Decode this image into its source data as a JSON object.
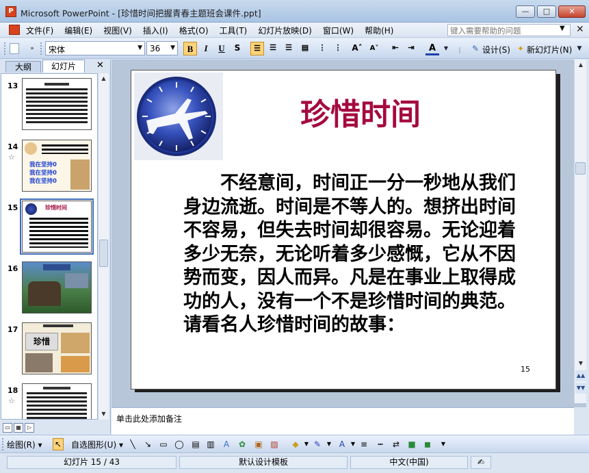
{
  "window": {
    "title": "Microsoft PowerPoint - [珍惜时间把握青春主题班会课件.ppt]",
    "app_icon_letter": "P",
    "min_glyph": "—",
    "max_glyph": "□",
    "close_glyph": "✕"
  },
  "menu": {
    "items": [
      "文件(F)",
      "编辑(E)",
      "视图(V)",
      "插入(I)",
      "格式(O)",
      "工具(T)",
      "幻灯片放映(D)",
      "窗口(W)",
      "帮助(H)"
    ],
    "help_placeholder": "键入需要帮助的问题",
    "close_glyph": "✕"
  },
  "toolbar": {
    "font_name": "宋体",
    "font_size": "36",
    "bold": "B",
    "italic": "I",
    "underline": "U",
    "shadow": "S",
    "design_label": "设计(S)",
    "new_slide_label": "新幻灯片(N)"
  },
  "left_pane": {
    "tab_outline": "大纲",
    "tab_slides": "幻灯片",
    "close_glyph": "✕",
    "thumbnails": [
      {
        "number": "13",
        "star": false,
        "selected": false
      },
      {
        "number": "14",
        "star": true,
        "selected": false
      },
      {
        "number": "15",
        "star": false,
        "selected": true
      },
      {
        "number": "16",
        "star": false,
        "selected": false
      },
      {
        "number": "17",
        "star": false,
        "selected": false
      },
      {
        "number": "18",
        "star": true,
        "selected": false
      }
    ],
    "thumb_texts": {
      "t14_lines": [
        "我在坚持0",
        "我在坚持0",
        "我在坚持0"
      ],
      "t15_title": "珍惜时间",
      "t17_title": "珍惜"
    }
  },
  "slide": {
    "title": "珍惜时间",
    "body": "不经意间，时间正一分一秒地从我们身边流逝。时间是不等人的。想挤出时间不容易，但失去时间却很容易。无论迎着多少无奈，无论听着多少感慨，它从不因势而变，因人而异。凡是在事业上取得成功的人，没有一个不是珍惜时间的典范。请看名人珍惜时间的故事：",
    "number": "15",
    "title_color": "#a50a3e"
  },
  "notes": {
    "placeholder": "单击此处添加备注"
  },
  "drawbar": {
    "draw_label": "绘图(R)",
    "autoshapes_label": "自选图形(U)"
  },
  "status": {
    "slide_pos": "幻灯片 15 / 43",
    "template": "默认设计模板",
    "language": "中文(中国)"
  }
}
